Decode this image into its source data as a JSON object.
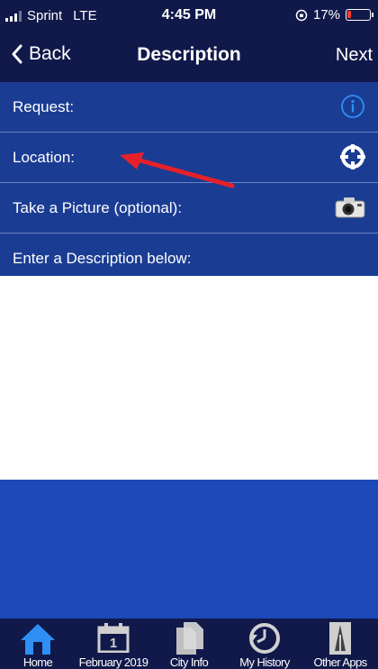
{
  "status_bar": {
    "carrier": "Sprint",
    "network": "LTE",
    "time": "4:45 PM",
    "battery": "17%",
    "battery_level": 0.17
  },
  "nav": {
    "back_label": "Back",
    "title": "Description",
    "next_label": "Next"
  },
  "rows": [
    {
      "label": "Request:",
      "icon": "info-icon"
    },
    {
      "label": "Location:",
      "icon": "crosshair-icon"
    },
    {
      "label": "Take a Picture (optional):",
      "icon": "camera-icon"
    },
    {
      "label": "Enter a Description below:",
      "icon": ""
    }
  ],
  "description_text": "",
  "tabs": [
    {
      "label": "Home",
      "icon": "home-icon"
    },
    {
      "label": "February 2019",
      "icon": "calendar-icon",
      "day": "1"
    },
    {
      "label": "City Info",
      "icon": "documents-icon"
    },
    {
      "label": "My History",
      "icon": "history-icon"
    },
    {
      "label": "Other Apps",
      "icon": "tower-icon"
    }
  ],
  "colors": {
    "bar_background": "#11194a",
    "row_background": "#1b3c93",
    "panel_background": "#1d49b8",
    "active_tab": "#2f8ff5",
    "annotation": "#e8202a"
  }
}
